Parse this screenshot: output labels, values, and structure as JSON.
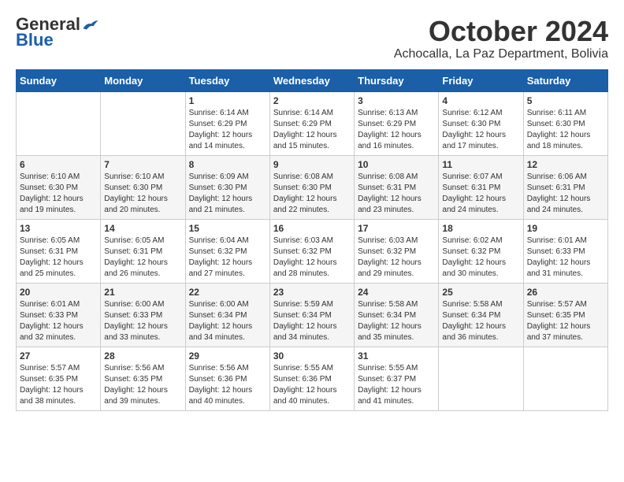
{
  "logo": {
    "general": "General",
    "blue": "Blue"
  },
  "header": {
    "month": "October 2024",
    "location": "Achocalla, La Paz Department, Bolivia"
  },
  "weekdays": [
    "Sunday",
    "Monday",
    "Tuesday",
    "Wednesday",
    "Thursday",
    "Friday",
    "Saturday"
  ],
  "weeks": [
    [
      {
        "day": "",
        "info": ""
      },
      {
        "day": "",
        "info": ""
      },
      {
        "day": "1",
        "info": "Sunrise: 6:14 AM\nSunset: 6:29 PM\nDaylight: 12 hours and 14 minutes."
      },
      {
        "day": "2",
        "info": "Sunrise: 6:14 AM\nSunset: 6:29 PM\nDaylight: 12 hours and 15 minutes."
      },
      {
        "day": "3",
        "info": "Sunrise: 6:13 AM\nSunset: 6:29 PM\nDaylight: 12 hours and 16 minutes."
      },
      {
        "day": "4",
        "info": "Sunrise: 6:12 AM\nSunset: 6:30 PM\nDaylight: 12 hours and 17 minutes."
      },
      {
        "day": "5",
        "info": "Sunrise: 6:11 AM\nSunset: 6:30 PM\nDaylight: 12 hours and 18 minutes."
      }
    ],
    [
      {
        "day": "6",
        "info": "Sunrise: 6:10 AM\nSunset: 6:30 PM\nDaylight: 12 hours and 19 minutes."
      },
      {
        "day": "7",
        "info": "Sunrise: 6:10 AM\nSunset: 6:30 PM\nDaylight: 12 hours and 20 minutes."
      },
      {
        "day": "8",
        "info": "Sunrise: 6:09 AM\nSunset: 6:30 PM\nDaylight: 12 hours and 21 minutes."
      },
      {
        "day": "9",
        "info": "Sunrise: 6:08 AM\nSunset: 6:30 PM\nDaylight: 12 hours and 22 minutes."
      },
      {
        "day": "10",
        "info": "Sunrise: 6:08 AM\nSunset: 6:31 PM\nDaylight: 12 hours and 23 minutes."
      },
      {
        "day": "11",
        "info": "Sunrise: 6:07 AM\nSunset: 6:31 PM\nDaylight: 12 hours and 24 minutes."
      },
      {
        "day": "12",
        "info": "Sunrise: 6:06 AM\nSunset: 6:31 PM\nDaylight: 12 hours and 24 minutes."
      }
    ],
    [
      {
        "day": "13",
        "info": "Sunrise: 6:05 AM\nSunset: 6:31 PM\nDaylight: 12 hours and 25 minutes."
      },
      {
        "day": "14",
        "info": "Sunrise: 6:05 AM\nSunset: 6:31 PM\nDaylight: 12 hours and 26 minutes."
      },
      {
        "day": "15",
        "info": "Sunrise: 6:04 AM\nSunset: 6:32 PM\nDaylight: 12 hours and 27 minutes."
      },
      {
        "day": "16",
        "info": "Sunrise: 6:03 AM\nSunset: 6:32 PM\nDaylight: 12 hours and 28 minutes."
      },
      {
        "day": "17",
        "info": "Sunrise: 6:03 AM\nSunset: 6:32 PM\nDaylight: 12 hours and 29 minutes."
      },
      {
        "day": "18",
        "info": "Sunrise: 6:02 AM\nSunset: 6:32 PM\nDaylight: 12 hours and 30 minutes."
      },
      {
        "day": "19",
        "info": "Sunrise: 6:01 AM\nSunset: 6:33 PM\nDaylight: 12 hours and 31 minutes."
      }
    ],
    [
      {
        "day": "20",
        "info": "Sunrise: 6:01 AM\nSunset: 6:33 PM\nDaylight: 12 hours and 32 minutes."
      },
      {
        "day": "21",
        "info": "Sunrise: 6:00 AM\nSunset: 6:33 PM\nDaylight: 12 hours and 33 minutes."
      },
      {
        "day": "22",
        "info": "Sunrise: 6:00 AM\nSunset: 6:34 PM\nDaylight: 12 hours and 34 minutes."
      },
      {
        "day": "23",
        "info": "Sunrise: 5:59 AM\nSunset: 6:34 PM\nDaylight: 12 hours and 34 minutes."
      },
      {
        "day": "24",
        "info": "Sunrise: 5:58 AM\nSunset: 6:34 PM\nDaylight: 12 hours and 35 minutes."
      },
      {
        "day": "25",
        "info": "Sunrise: 5:58 AM\nSunset: 6:34 PM\nDaylight: 12 hours and 36 minutes."
      },
      {
        "day": "26",
        "info": "Sunrise: 5:57 AM\nSunset: 6:35 PM\nDaylight: 12 hours and 37 minutes."
      }
    ],
    [
      {
        "day": "27",
        "info": "Sunrise: 5:57 AM\nSunset: 6:35 PM\nDaylight: 12 hours and 38 minutes."
      },
      {
        "day": "28",
        "info": "Sunrise: 5:56 AM\nSunset: 6:35 PM\nDaylight: 12 hours and 39 minutes."
      },
      {
        "day": "29",
        "info": "Sunrise: 5:56 AM\nSunset: 6:36 PM\nDaylight: 12 hours and 40 minutes."
      },
      {
        "day": "30",
        "info": "Sunrise: 5:55 AM\nSunset: 6:36 PM\nDaylight: 12 hours and 40 minutes."
      },
      {
        "day": "31",
        "info": "Sunrise: 5:55 AM\nSunset: 6:37 PM\nDaylight: 12 hours and 41 minutes."
      },
      {
        "day": "",
        "info": ""
      },
      {
        "day": "",
        "info": ""
      }
    ]
  ]
}
